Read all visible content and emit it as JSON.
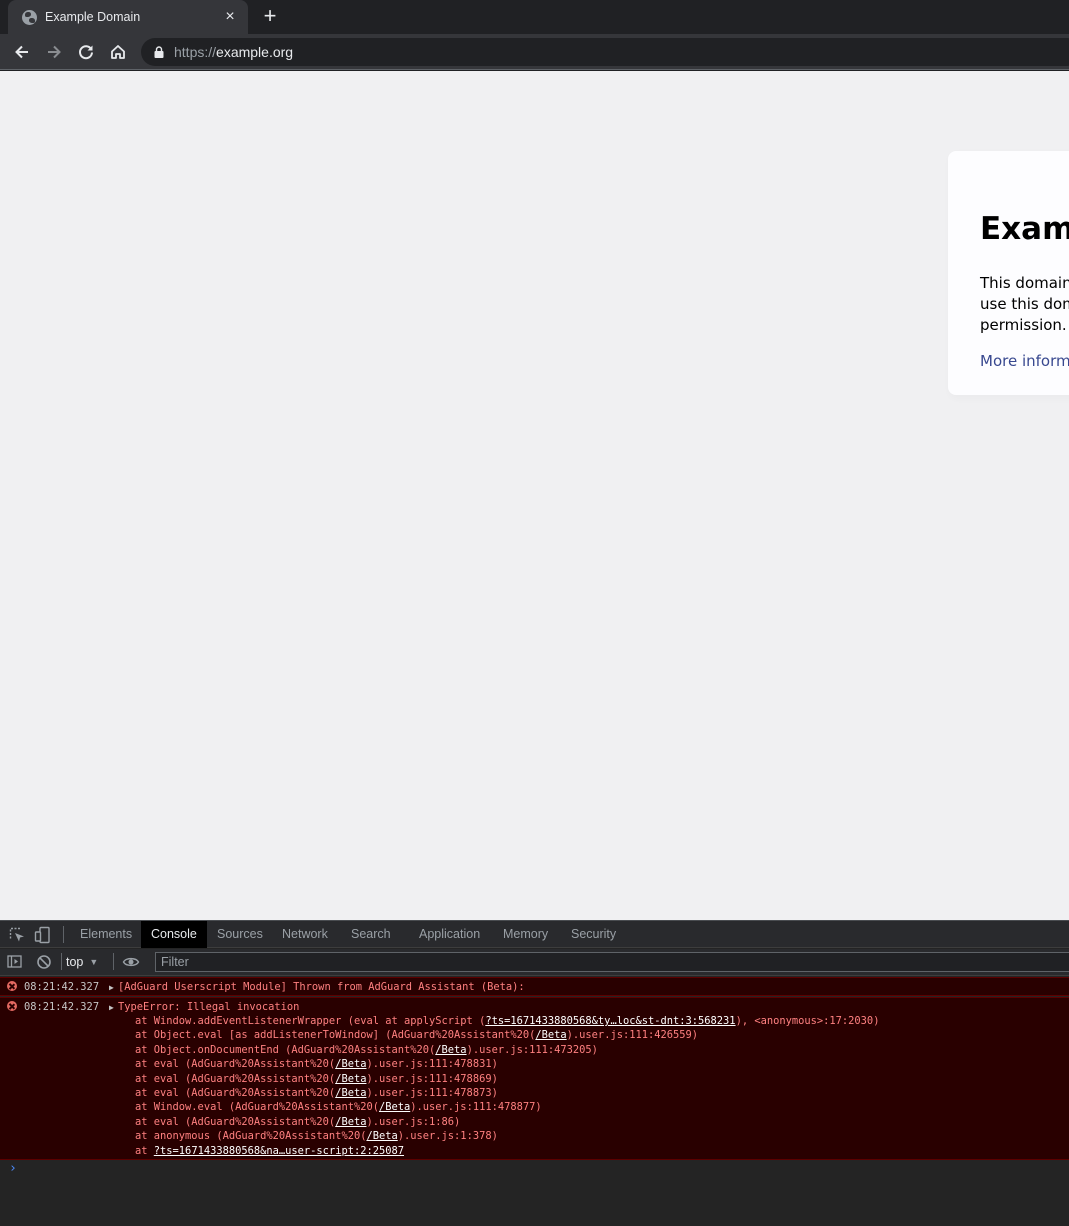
{
  "browser": {
    "tab_title": "Example Domain",
    "tab_close": "×",
    "new_tab": "+",
    "url_scheme": "https://",
    "url_host": "example.org"
  },
  "page": {
    "heading": "Example Domain",
    "paragraph": "This domain is for use in illustrative examples in documents. You may use this domain in literature without prior coordination or asking for permission.",
    "link_text": "More information..."
  },
  "devtools": {
    "tabs": [
      "Elements",
      "Console",
      "Sources",
      "Network",
      "Search",
      "Application",
      "Memory",
      "Security"
    ],
    "active_tab": "Console",
    "context": "top",
    "context_arrow": "▼",
    "filter_placeholder": "Filter",
    "prompt_symbol": "›",
    "messages": [
      {
        "level": "error",
        "timestamp": "08:21:42.327",
        "expander": "▶",
        "text": "[AdGuard Userscript Module] Thrown from AdGuard Assistant (Beta):"
      },
      {
        "level": "error",
        "timestamp": "08:21:42.327",
        "expander": "▶",
        "text": "TypeError: Illegal invocation",
        "stack": [
          {
            "pre": "at Window.addEventListenerWrapper (eval at applyScript (",
            "link": "?ts=1671433880568&ty…loc&st-dnt:3:568231",
            "post": "), <anonymous>:17:2030)"
          },
          {
            "pre": "at Object.eval [as addListenerToWindow] (AdGuard%20Assistant%20(",
            "link": "/Beta",
            "post": ").user.js:111:426559)"
          },
          {
            "pre": "at Object.onDocumentEnd (AdGuard%20Assistant%20(",
            "link": "/Beta",
            "post": ").user.js:111:473205)"
          },
          {
            "pre": "at eval (AdGuard%20Assistant%20(",
            "link": "/Beta",
            "post": ").user.js:111:478831)"
          },
          {
            "pre": "at eval (AdGuard%20Assistant%20(",
            "link": "/Beta",
            "post": ").user.js:111:478869)"
          },
          {
            "pre": "at eval (AdGuard%20Assistant%20(",
            "link": "/Beta",
            "post": ").user.js:111:478873)"
          },
          {
            "pre": "at Window.eval (AdGuard%20Assistant%20(",
            "link": "/Beta",
            "post": ").user.js:111:478877)"
          },
          {
            "pre": "at eval (AdGuard%20Assistant%20(",
            "link": "/Beta",
            "post": ").user.js:1:86)"
          },
          {
            "pre": "at anonymous (AdGuard%20Assistant%20(",
            "link": "/Beta",
            "post": ").user.js:1:378)"
          },
          {
            "pre": "at ",
            "link": "?ts=1671433880568&na…user-script:2:25087",
            "post": ""
          }
        ]
      }
    ]
  }
}
